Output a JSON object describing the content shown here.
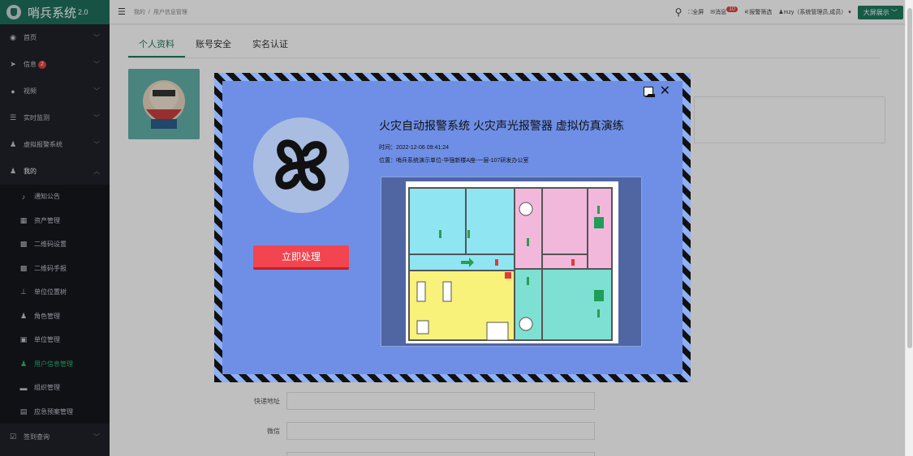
{
  "app": {
    "name": "哨兵系统",
    "version": "2.0"
  },
  "sidebar": {
    "items": [
      {
        "label": "首页",
        "icon": "dashboard-icon"
      },
      {
        "label": "信息",
        "icon": "send-icon",
        "badge": "2"
      },
      {
        "label": "视频",
        "icon": "video-icon"
      },
      {
        "label": "实时监测",
        "icon": "list-icon"
      },
      {
        "label": "虚拟报警系统",
        "icon": "user-icon"
      },
      {
        "label": "我的",
        "icon": "user-icon"
      }
    ],
    "sub_items": [
      {
        "label": "通知公告",
        "icon": "bell-icon"
      },
      {
        "label": "资产管理",
        "icon": "box-icon"
      },
      {
        "label": "二维码设置",
        "icon": "qrcode-icon"
      },
      {
        "label": "二维码手报",
        "icon": "qrcode-icon"
      },
      {
        "label": "单位位置树",
        "icon": "tree-icon"
      },
      {
        "label": "角色管理",
        "icon": "user-icon"
      },
      {
        "label": "单位管理",
        "icon": "lock-icon"
      },
      {
        "label": "用户信息管理",
        "icon": "user-icon"
      },
      {
        "label": "组织管理",
        "icon": "folder-icon"
      },
      {
        "label": "应急预案管理",
        "icon": "doc-icon"
      }
    ],
    "footer_item": {
      "label": "签到查询",
      "icon": "checkin-icon"
    }
  },
  "header": {
    "breadcrumb": [
      "我的",
      "用户信息管理"
    ],
    "fullscreen": "全屏",
    "messages": "消息",
    "message_count": "10",
    "alarm_filter": "报警筛选",
    "user": "mzy（系统管理员,成员）",
    "big_screen": "大屏展示"
  },
  "tabs": [
    "个人资料",
    "账号安全",
    "实名认证"
  ],
  "form": {
    "fields": [
      {
        "label": "快递地址",
        "value": ""
      },
      {
        "label": "微信",
        "value": ""
      }
    ]
  },
  "alarm_modal": {
    "title": "火灾自动报警系统 火灾声光报警器 虚拟仿真演练",
    "time": "时间：2022-12-06 09:41:24",
    "location": "位置：哨兵系统演示单位-华强新楼A座-一层-107研发办公室",
    "action_button": "立即处理",
    "colors": {
      "frame_dark": "#111111",
      "frame_light": "#8fb0f2",
      "panel": "#6f8fe6",
      "button": "#f2454f"
    }
  }
}
